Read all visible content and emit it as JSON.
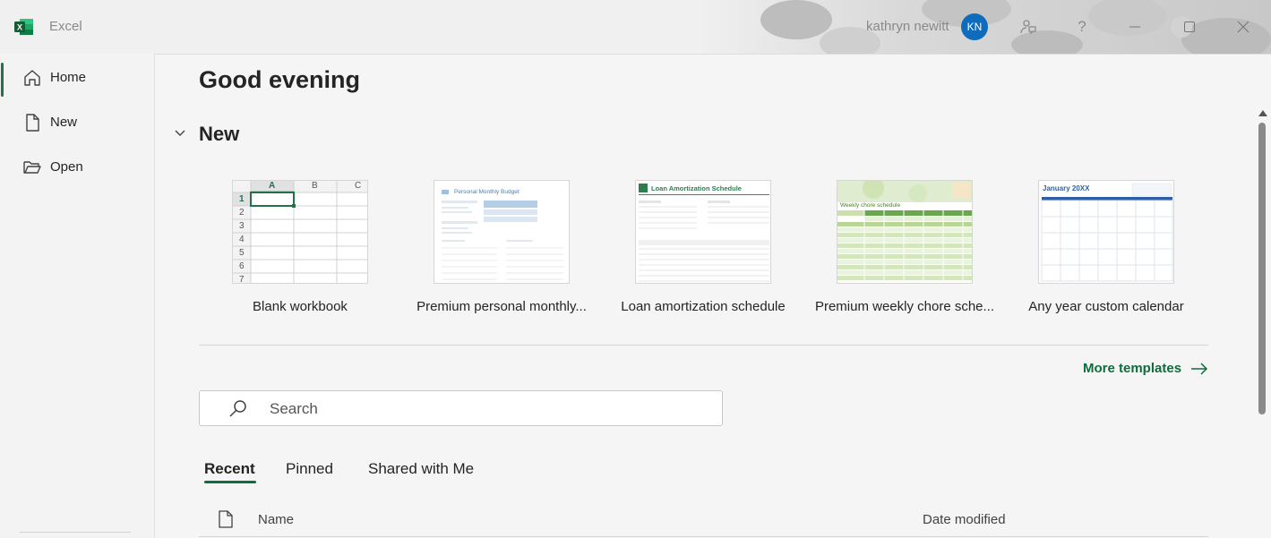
{
  "titlebar": {
    "app_name": "Excel",
    "user_name": "kathryn newitt",
    "avatar_initials": "KN",
    "avatar_color": "#0f6cbd"
  },
  "sidebar": {
    "items": [
      {
        "label": "Home",
        "icon": "home-icon",
        "active": true
      },
      {
        "label": "New",
        "icon": "new-file-icon",
        "active": false
      },
      {
        "label": "Open",
        "icon": "folder-open-icon",
        "active": false
      }
    ]
  },
  "main": {
    "greeting": "Good evening",
    "section_title": "New",
    "templates": [
      {
        "label": "Blank workbook",
        "thumb": "blank"
      },
      {
        "label": "Premium personal monthly...",
        "thumb": "budget"
      },
      {
        "label": "Loan amortization schedule",
        "thumb": "loan"
      },
      {
        "label": "Premium weekly chore sche...",
        "thumb": "chore"
      },
      {
        "label": "Any year custom calendar",
        "thumb": "calendar"
      }
    ],
    "blank_thumb": {
      "columns": [
        "A",
        "B",
        "C"
      ],
      "rows": [
        "1",
        "2",
        "3",
        "4",
        "5",
        "6",
        "7"
      ]
    },
    "budget_thumb_title": "Personal Monthly Budget",
    "loan_thumb_title": "Loan Amortization Schedule",
    "chore_thumb_title": "Weekly chore schedule",
    "calendar_thumb_title": "January 20XX",
    "more_templates": "More templates",
    "search_placeholder": "Search",
    "tabs": [
      {
        "label": "Recent",
        "active": true
      },
      {
        "label": "Pinned",
        "active": false
      },
      {
        "label": "Shared with Me",
        "active": false
      }
    ],
    "columns": {
      "name": "Name",
      "date_modified": "Date modified"
    }
  },
  "colors": {
    "accent_green": "#0e6d3c",
    "excel_green": "#217346"
  }
}
